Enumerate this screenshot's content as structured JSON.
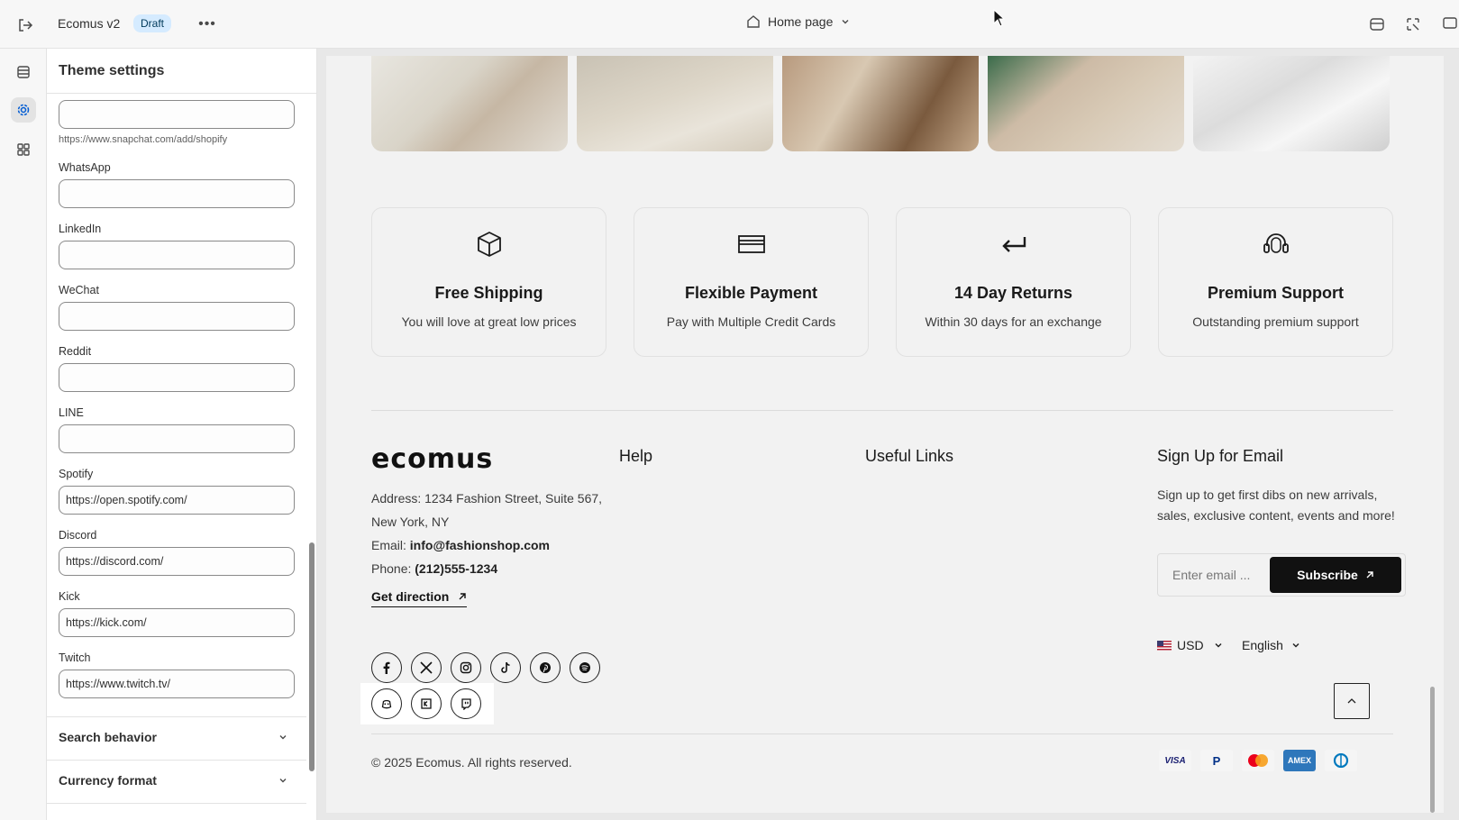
{
  "topbar": {
    "store_name": "Ecomus v2",
    "status_badge": "Draft",
    "more_label": "•••",
    "page_selector": "Home page"
  },
  "panel": {
    "title": "Theme settings",
    "snapchat_hint": "https://www.snapchat.com/add/shopify",
    "fields": [
      {
        "label": "WhatsApp",
        "value": ""
      },
      {
        "label": "LinkedIn",
        "value": ""
      },
      {
        "label": "WeChat",
        "value": ""
      },
      {
        "label": "Reddit",
        "value": ""
      },
      {
        "label": "LINE",
        "value": ""
      },
      {
        "label": "Spotify",
        "value": "https://open.spotify.com/"
      },
      {
        "label": "Discord",
        "value": "https://discord.com/"
      },
      {
        "label": "Kick",
        "value": "https://kick.com/"
      },
      {
        "label": "Twitch",
        "value": "https://www.twitch.tv/"
      }
    ],
    "sections": [
      {
        "label": "Search behavior"
      },
      {
        "label": "Currency format"
      }
    ]
  },
  "preview": {
    "features": [
      {
        "icon": "box-icon",
        "title": "Free Shipping",
        "desc": "You will love at great low prices"
      },
      {
        "icon": "credit-card-icon",
        "title": "Flexible Payment",
        "desc": "Pay with Multiple Credit Cards"
      },
      {
        "icon": "return-arrow-icon",
        "title": "14 Day Returns",
        "desc": "Within 30 days for an exchange"
      },
      {
        "icon": "headset-icon",
        "title": "Premium Support",
        "desc": "Outstanding premium support"
      }
    ],
    "footer": {
      "logo": "ecomus",
      "help_title": "Help",
      "links_title": "Useful Links",
      "signup_title": "Sign Up for Email",
      "address_line1": "Address: 1234 Fashion Street, Suite 567,",
      "address_line2": "New York, NY",
      "email_label": "Email: ",
      "email": "info@fashionshop.com",
      "phone_label": "Phone: ",
      "phone": "(212)555-1234",
      "get_direction": "Get direction",
      "signup_text": "Sign up to get first dibs on new arrivals, sales, exclusive content, events and more!",
      "email_placeholder": "Enter email ...",
      "subscribe": "Subscribe",
      "currency": "USD",
      "language": "English",
      "copyright": "© 2025 Ecomus. All rights reserved.",
      "social_icons": [
        "facebook-icon",
        "x-icon",
        "instagram-icon",
        "tiktok-icon",
        "pinterest-icon",
        "spotify-icon"
      ],
      "social_icons_new": [
        "discord-icon",
        "kick-icon",
        "twitch-icon"
      ],
      "payments": [
        "VISA",
        "PayPal",
        "Mastercard",
        "AMEX",
        "Diners"
      ]
    }
  }
}
